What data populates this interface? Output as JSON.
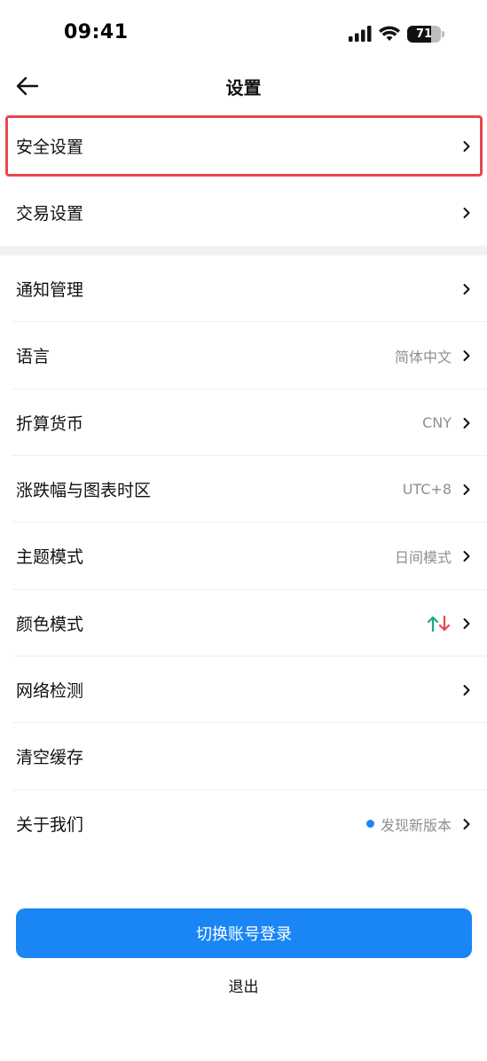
{
  "status_bar": {
    "time": "09:41",
    "battery_level": "71"
  },
  "nav": {
    "title": "设置"
  },
  "rows": [
    {
      "key": "security",
      "label": "安全设置",
      "value": ""
    },
    {
      "key": "trading",
      "label": "交易设置",
      "value": ""
    },
    {
      "key": "notifications",
      "label": "通知管理",
      "value": ""
    },
    {
      "key": "language",
      "label": "语言",
      "value": "简体中文"
    },
    {
      "key": "currency",
      "label": "折算货币",
      "value": "CNY"
    },
    {
      "key": "timezone",
      "label": "涨跌幅与图表时区",
      "value": "UTC+8"
    },
    {
      "key": "theme",
      "label": "主题模式",
      "value": "日间模式"
    },
    {
      "key": "color",
      "label": "颜色模式",
      "value": ""
    },
    {
      "key": "network",
      "label": "网络检测",
      "value": ""
    },
    {
      "key": "cache",
      "label": "清空缓存",
      "value": ""
    },
    {
      "key": "about",
      "label": "关于我们",
      "value": "发现新版本"
    }
  ],
  "color_mode": {
    "up_color": "#1ba97a",
    "down_color": "#e5484d"
  },
  "accent_color": "#1a86f5",
  "actions": {
    "switch_account": "切换账号登录",
    "logout": "退出"
  }
}
